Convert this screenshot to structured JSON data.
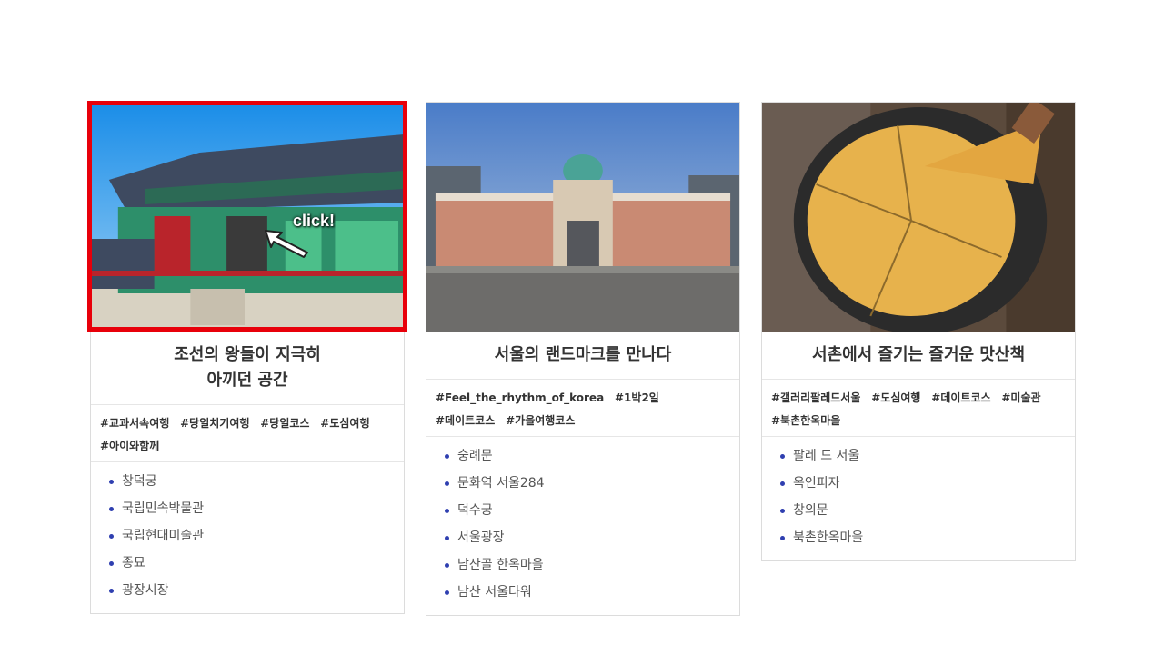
{
  "annotation": {
    "click_text": "click!"
  },
  "cards": [
    {
      "title_line1": "조선의 왕들이 지극히",
      "title_line2": "아끼던 공간",
      "tags": [
        "#교과서속여행",
        "#당일치기여행",
        "#당일코스",
        "#도심여행",
        "#아이와함께"
      ],
      "items": [
        "창덕궁",
        "국립민속박물관",
        "국립현대미술관",
        "종묘",
        "광장시장"
      ]
    },
    {
      "title_line1": "서울의 랜드마크를 만나다",
      "tags": [
        "#Feel_the_rhythm_of_korea",
        "#1박2일",
        "#데이트코스",
        "#가을여행코스"
      ],
      "items": [
        "숭례문",
        "문화역 서울284",
        "덕수궁",
        "서울광장",
        "남산골 한옥마을",
        "남산 서울타워"
      ]
    },
    {
      "title_line1": "서촌에서 즐기는 즐거운 맛산책",
      "tags": [
        "#갤러리팔레드서울",
        "#도심여행",
        "#데이트코스",
        "#미술관",
        "#북촌한옥마을"
      ],
      "items": [
        "팔레 드 서울",
        "옥인피자",
        "창의문",
        "북촌한옥마을"
      ]
    }
  ],
  "colors": {
    "highlight": "#e8000a",
    "bullet": "#2f3fb0",
    "border": "#dcdcdc"
  }
}
